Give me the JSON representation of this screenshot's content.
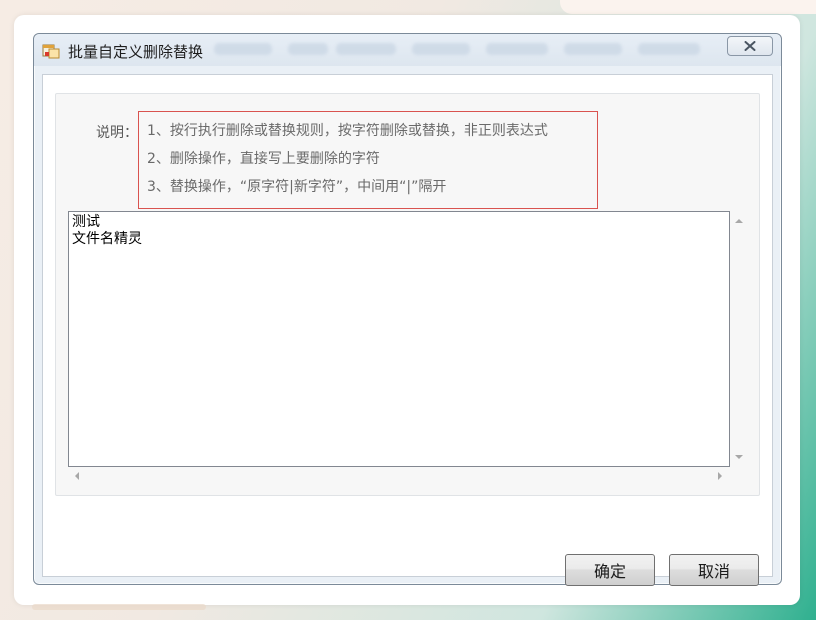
{
  "window": {
    "title": "批量自定义删除替换"
  },
  "description": {
    "label": "说明：",
    "lines": [
      "1、按行执行删除或替换规则，按字符删除或替换，非正则表达式",
      "2、删除操作，直接写上要删除的字符",
      "3、替换操作，“原字符|新字符”，中间用“|”隔开"
    ]
  },
  "editor": {
    "lines": [
      "测试",
      "文件名精灵"
    ]
  },
  "buttons": {
    "ok": "确定",
    "cancel": "取消"
  },
  "colors": {
    "highlight_border": "#d9534f",
    "window_border": "#7b8a99",
    "background_accent": "#2fb08f"
  },
  "icons": {
    "app": "app-window-icon",
    "close": "close-icon"
  }
}
